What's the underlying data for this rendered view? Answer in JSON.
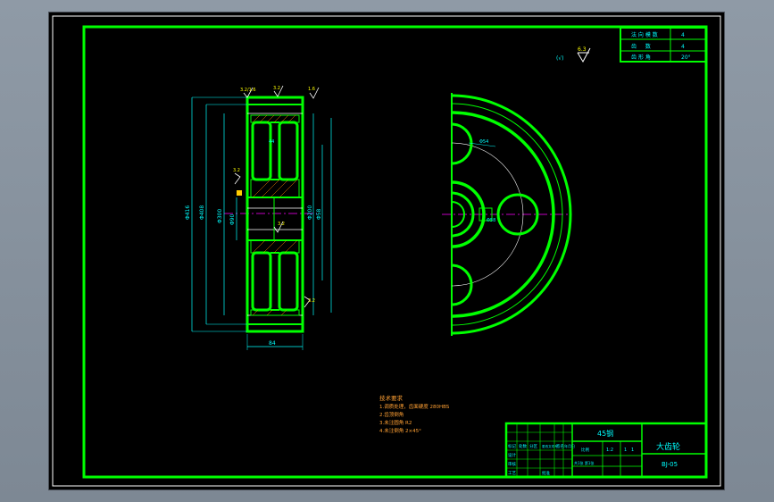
{
  "colors": {
    "border": "#00ff00",
    "frame": "#ffffff",
    "dimension": "#00ffff",
    "centerline": "#ff00ff",
    "notes": "#ffa033",
    "background": "#000000"
  },
  "corner_table": {
    "rows": [
      {
        "label": "法 向 模 数",
        "value": "4"
      },
      {
        "label": "齿 　 数",
        "value": "4"
      },
      {
        "label": "齿 形 角",
        "value": "20°"
      }
    ]
  },
  "roughness": {
    "top_right": "6.3",
    "other": "(√)",
    "side_a": "3.2/1.6",
    "side_b": "3.2",
    "side_c": "1.6",
    "left_mid": "3.2",
    "hub_mark": "3.2",
    "bottom_mark": "3.2"
  },
  "dimensions": {
    "outer_dia": "Φ416",
    "root_dia": "Φ408",
    "bore": "Φ58",
    "hub": "Φ90",
    "rim_inner": "Φ300",
    "hole_circle": "Φ200",
    "width": "84",
    "face": "44",
    "hole_dia": "Φ54"
  },
  "tech_notes": {
    "title": "技术要求",
    "lines": [
      "1.调质处理，齿面硬度 280HBS",
      "2.齿顶倒角",
      "3.未注圆角 R2",
      "4.未注倒角 2×45°"
    ]
  },
  "title_block": {
    "material": "45钢",
    "part_name": "大齿轮",
    "drawing_no": "BJ-05",
    "scale_label": "比例",
    "scale": "1:2",
    "sheet": "共1张 第1张",
    "rev_labels": [
      "标记",
      "处数",
      "分区",
      "更改文件号",
      "签名",
      "年月日"
    ],
    "role_labels": [
      "设计",
      "审核",
      "工艺",
      "批准"
    ],
    "small_cells": [
      "1",
      "1"
    ]
  }
}
